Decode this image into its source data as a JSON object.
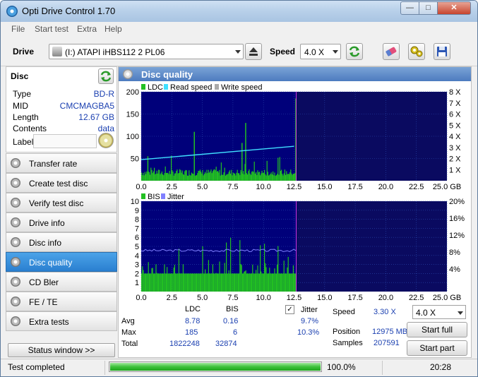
{
  "window": {
    "title": "Opti Drive Control 1.70",
    "min_label": "—",
    "max_label": "□",
    "close_label": "✕"
  },
  "menu": [
    "File",
    "Start test",
    "Extra",
    "Help"
  ],
  "toolbar": {
    "drive_label": "Drive",
    "drive_value": "(I:)   ATAPI iHBS112   2 PL06",
    "speed_label": "Speed",
    "speed_value": "4.0 X"
  },
  "disc": {
    "header": "Disc",
    "rows": [
      {
        "k": "Type",
        "v": "BD-R"
      },
      {
        "k": "MID",
        "v": "CMCMAGBA5"
      },
      {
        "k": "Length",
        "v": "12.67 GB"
      },
      {
        "k": "Contents",
        "v": "data"
      }
    ],
    "label_key": "Label"
  },
  "nav": [
    {
      "label": "Transfer rate",
      "active": false
    },
    {
      "label": "Create test disc",
      "active": false
    },
    {
      "label": "Verify test disc",
      "active": false
    },
    {
      "label": "Drive info",
      "active": false
    },
    {
      "label": "Disc info",
      "active": false
    },
    {
      "label": "Disc quality",
      "active": true
    },
    {
      "label": "CD Bler",
      "active": false
    },
    {
      "label": "FE / TE",
      "active": false
    },
    {
      "label": "Extra tests",
      "active": false
    }
  ],
  "status_window_btn": "Status window >>",
  "main": {
    "title": "Disc quality"
  },
  "chart_data": [
    {
      "type": "area",
      "legend": [
        "LDC",
        "Read speed",
        "Write speed"
      ],
      "colors": {
        "LDC": "#22c022",
        "Read speed": "#40e0ff",
        "Write speed": "#aaaaaa",
        "bg_data": "#00007a",
        "bg_empty": "#0a0a60"
      },
      "xlim": [
        0,
        25
      ],
      "x_ticks": [
        "0.0",
        "2.5",
        "5.0",
        "7.5",
        "10.0",
        "12.5",
        "15.0",
        "17.5",
        "20.0",
        "22.5",
        "25.0 GB"
      ],
      "ylim": [
        0,
        200
      ],
      "y_ticks": [
        "200",
        "150",
        "100",
        "50"
      ],
      "y2_ticks": [
        "8 X",
        "7 X",
        "6 X",
        "5 X",
        "4 X",
        "3 X",
        "2 X",
        "1 X"
      ],
      "data_end_gb": 12.67,
      "ldc_baseline": 20,
      "ldc_spikes": [
        {
          "x": 0.5,
          "y": 55
        },
        {
          "x": 4.3,
          "y": 110
        },
        {
          "x": 8.2,
          "y": 85
        },
        {
          "x": 8.5,
          "y": 130
        },
        {
          "x": 12.6,
          "y": 185
        }
      ],
      "read_speed": {
        "start": [
          0,
          1.9
        ],
        "end": [
          12.5,
          3.1
        ]
      }
    },
    {
      "type": "area",
      "legend": [
        "BIS",
        "Jitter"
      ],
      "colors": {
        "BIS": "#22c022",
        "Jitter": "#8080ff",
        "bg_data": "#00007a",
        "bg_empty": "#0a0a60"
      },
      "xlim": [
        0,
        25
      ],
      "x_ticks": [
        "0.0",
        "2.5",
        "5.0",
        "7.5",
        "10.0",
        "12.5",
        "15.0",
        "17.5",
        "20.0",
        "22.5",
        "25.0 GB"
      ],
      "ylim": [
        0,
        10
      ],
      "y_ticks": [
        "10",
        "9",
        "8",
        "7",
        "6",
        "5",
        "4",
        "3",
        "2",
        "1"
      ],
      "y2_ticks": [
        "20%",
        "16%",
        "12%",
        "8%",
        "4%"
      ],
      "data_end_gb": 12.67,
      "bis_baseline": 2,
      "bis_max": 6,
      "jitter_avg": 9.7
    }
  ],
  "stats": {
    "col_ldc": "LDC",
    "col_bis": "BIS",
    "jitter_label": "Jitter",
    "jitter_checked": "✓",
    "avg_label": "Avg",
    "max_label": "Max",
    "total_label": "Total",
    "avg_ldc": "8.78",
    "avg_bis": "0.16",
    "avg_jitter": "9.7%",
    "max_ldc": "185",
    "max_bis": "6",
    "max_jitter": "10.3%",
    "total_ldc": "1822248",
    "total_bis": "32874",
    "speed_label": "Speed",
    "speed_value": "3.30 X",
    "position_label": "Position",
    "position_value": "12975 MB",
    "samples_label": "Samples",
    "samples_value": "207591",
    "speed_select": "4.0 X",
    "start_full": "Start full",
    "start_part": "Start part"
  },
  "statusbar": {
    "text": "Test completed",
    "progress": 1.0,
    "percent": "100.0%",
    "time": "20:28"
  }
}
